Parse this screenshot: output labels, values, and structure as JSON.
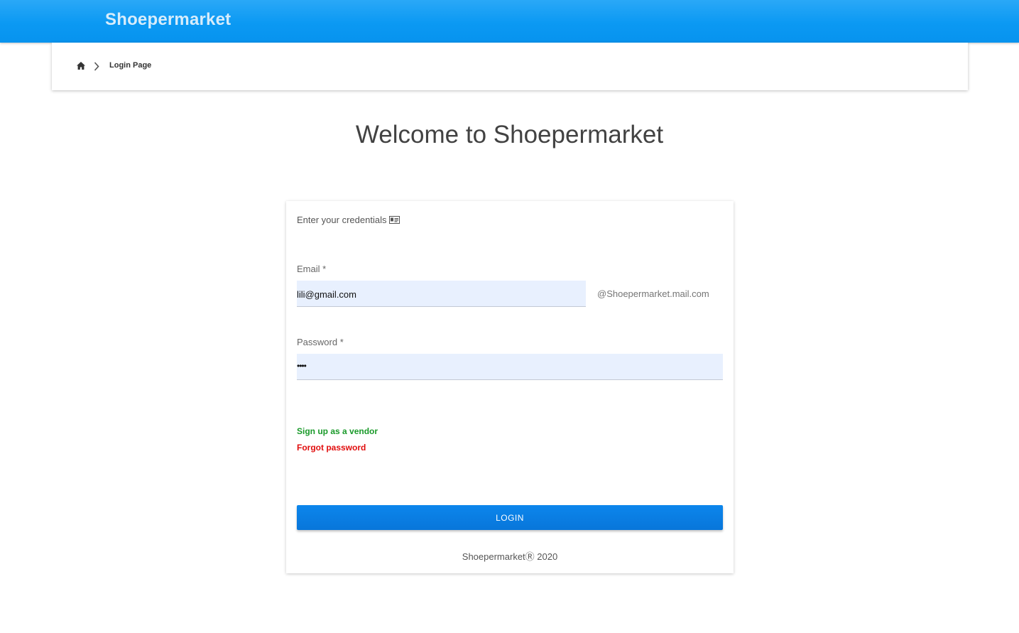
{
  "header": {
    "brand": "Shoepermarket"
  },
  "breadcrumb": {
    "home_icon": "home-icon",
    "separator_icon": "chevron-right-icon",
    "current": "Login Page"
  },
  "main": {
    "welcome": "Welcome to Shoepermarket"
  },
  "login_card": {
    "prompt": "Enter your credentials",
    "prompt_icon": "id-card-icon",
    "email": {
      "label": "Email *",
      "value": "lili@gmail.com",
      "suffix": "@Shoepermarket.mail.com"
    },
    "password": {
      "label": "Password *",
      "masked_value": "••••"
    },
    "signup_link": "Sign up as a vendor",
    "forgot_link": "Forgot password",
    "login_button": "LOGIN",
    "footer": "ShoepermarketⓇ 2020"
  },
  "colors": {
    "header_blue": "#0b99f3",
    "button_blue": "#0a7fe4",
    "signup_green": "#1a9a2a",
    "forgot_red": "#e10d0d",
    "input_bg": "#e8f0fe"
  }
}
